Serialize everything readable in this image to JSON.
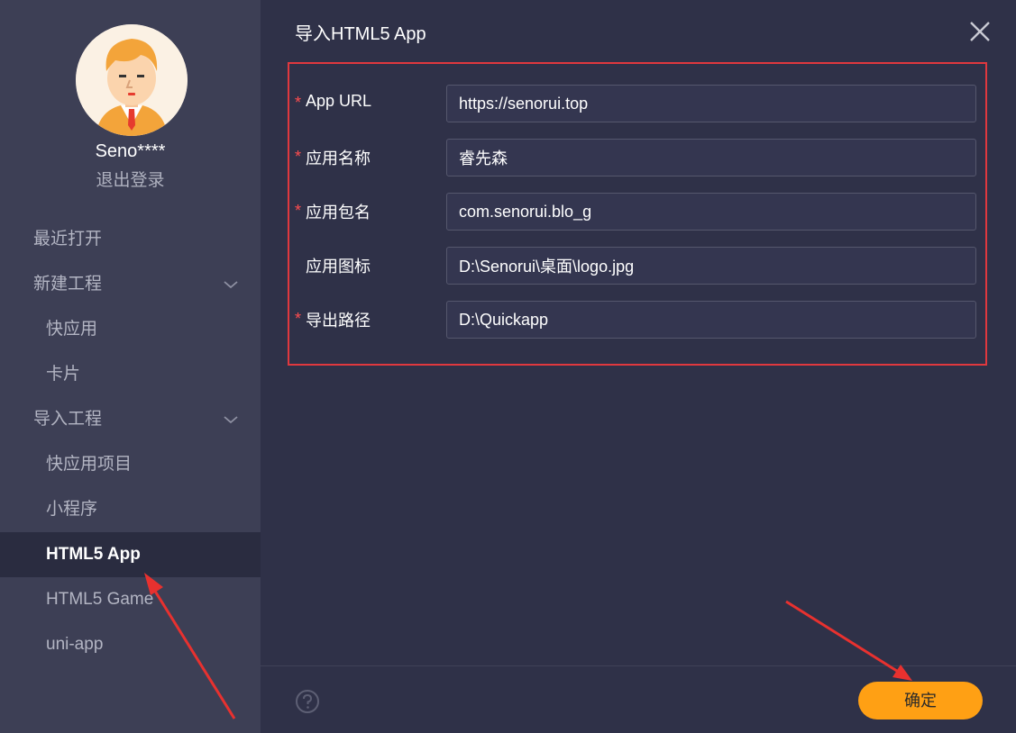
{
  "sidebar": {
    "username": "Seno****",
    "logout_label": "退出登录",
    "items": [
      {
        "label": "最近打开"
      },
      {
        "label": "新建工程"
      },
      {
        "label": "快应用"
      },
      {
        "label": "卡片"
      },
      {
        "label": "导入工程"
      },
      {
        "label": "快应用项目"
      },
      {
        "label": "小程序"
      },
      {
        "label": "HTML5 App"
      },
      {
        "label": "HTML5 Game"
      },
      {
        "label": "uni-app"
      }
    ]
  },
  "dialog": {
    "title": "导入HTML5 App",
    "fields": [
      {
        "label": "App URL",
        "required_mark": "*",
        "value": "https://senorui.top"
      },
      {
        "label": "应用名称",
        "required_mark": "*",
        "value": "睿先森"
      },
      {
        "label": "应用包名",
        "required_mark": "*",
        "value": "com.senorui.blo_g"
      },
      {
        "label": "应用图标",
        "required_mark": "",
        "value": "D:\\Senorui\\桌面\\logo.jpg"
      },
      {
        "label": "导出路径",
        "required_mark": "*",
        "value": "D:\\Quickapp"
      }
    ],
    "confirm_label": "确定"
  },
  "colors": {
    "sidebar_bg": "#3d3f55",
    "main_bg": "#2f3148",
    "accent": "#ffa014",
    "highlight_border": "#e0383e",
    "annotation_arrow": "#e8312f"
  },
  "icons": {
    "close": "close-icon",
    "help": "help-icon",
    "expand": "chevron-down-icon",
    "avatar": "avatar"
  }
}
